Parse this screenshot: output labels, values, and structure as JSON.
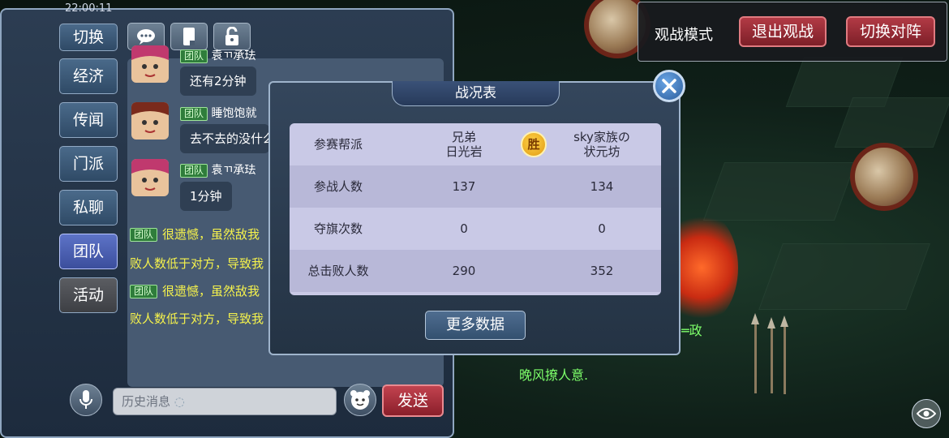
{
  "status_bar": {
    "time": "22:00:11"
  },
  "spectate_bar": {
    "mode_label": "观战模式",
    "exit_label": "退出观战",
    "switch_label": "切换对阵"
  },
  "chat": {
    "tabs": [
      {
        "label": "切换"
      },
      {
        "label": "经济"
      },
      {
        "label": "传闻"
      },
      {
        "label": "门派"
      },
      {
        "label": "私聊"
      },
      {
        "label": "团队",
        "active": true
      },
      {
        "label": "活动"
      }
    ],
    "tool_icons": [
      "chat-bubble-icon",
      "phone-icon",
      "unlock-icon"
    ],
    "messages": [
      {
        "tag": "团队",
        "name": "袁ㄲ承珐",
        "text": "还有2分钟"
      },
      {
        "tag": "团队",
        "name": "睡饱饱就",
        "text": "去不去的没什么"
      },
      {
        "tag": "团队",
        "name": "袁ㄲ承珐",
        "text": "1分钟"
      }
    ],
    "system_lines": [
      {
        "tag": "团队",
        "text": "很遗憾，虽然敌我"
      },
      {
        "text": "败人数低于对方，导致我"
      },
      {
        "tag": "团队",
        "text": "很遗憾，虽然敌我"
      },
      {
        "text": "败人数低于对方，导致我"
      }
    ],
    "input_placeholder": "历史消息",
    "send_label": "发送"
  },
  "battle_report": {
    "title": "战况表",
    "win_badge": "胜",
    "header": {
      "label": "参赛帮派",
      "team_a": "兄弟\n日光岩",
      "team_b": "sky家族の\n状元坊"
    },
    "rows": [
      {
        "label": "参战人数",
        "team_a": "137",
        "team_b": "134"
      },
      {
        "label": "夺旗次数",
        "team_a": "0",
        "team_b": "0"
      },
      {
        "label": "总击败人数",
        "team_a": "290",
        "team_b": "352"
      }
    ],
    "more_label": "更多数据"
  },
  "scene": {
    "green_text": "晚风撩人意.",
    "side_text": "═政"
  },
  "colors": {
    "accent_red": "#b23a45",
    "system_yellow": "#f5f24c",
    "team_green": "#2f7d3b"
  }
}
